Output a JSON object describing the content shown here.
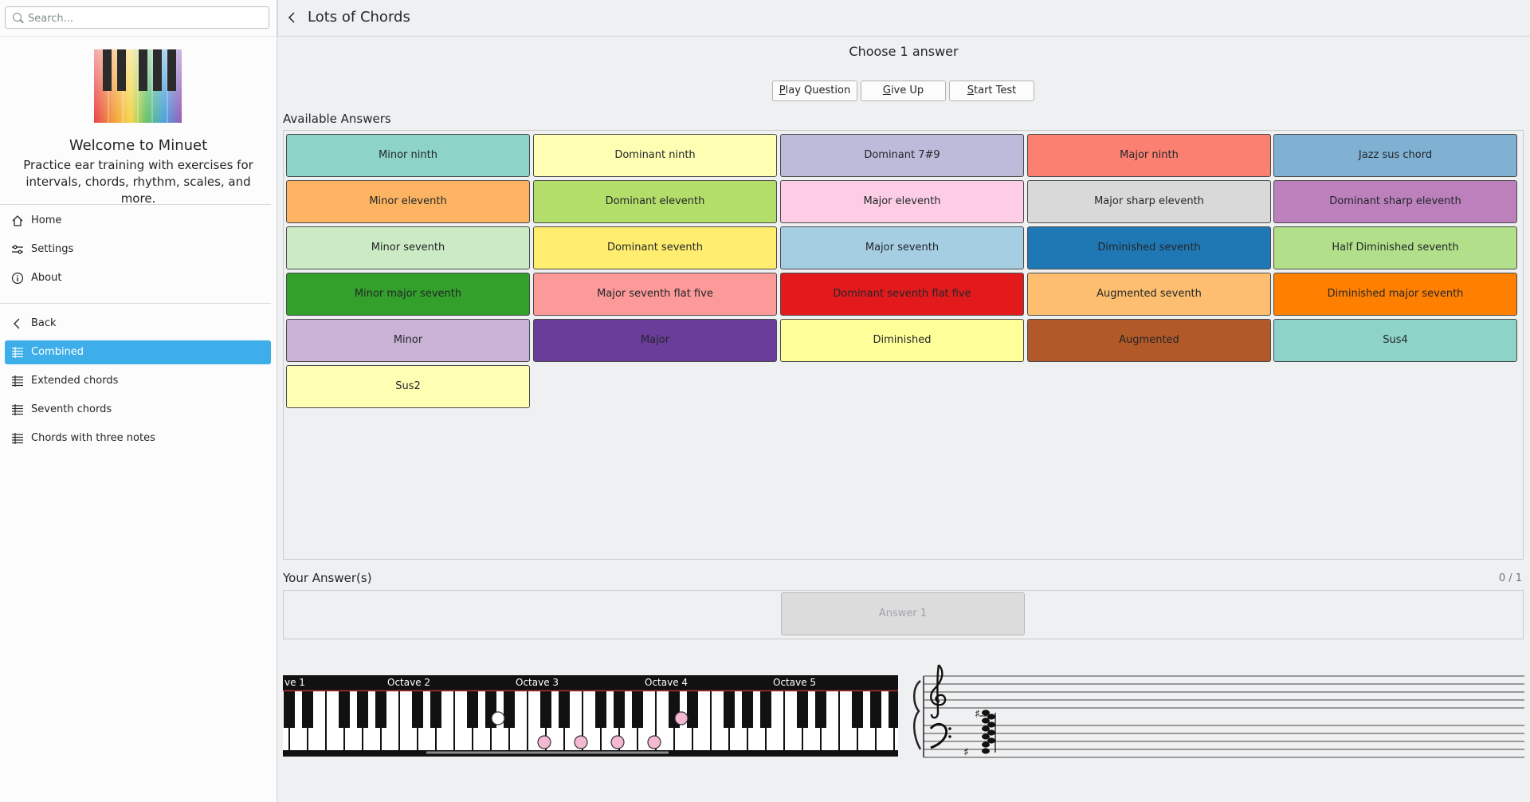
{
  "sidebar": {
    "search_placeholder": "Search...",
    "welcome": "Welcome to Minuet",
    "tagline": "Practice ear training with exercises for intervals, chords, rhythm, scales, and more.",
    "nav": [
      {
        "label": "Home",
        "icon": "home-icon"
      },
      {
        "label": "Settings",
        "icon": "settings-icon"
      },
      {
        "label": "About",
        "icon": "info-icon"
      }
    ],
    "back_label": "Back",
    "categories": [
      {
        "label": "Combined",
        "active": true
      },
      {
        "label": "Extended chords",
        "active": false
      },
      {
        "label": "Seventh chords",
        "active": false
      },
      {
        "label": "Chords with three notes",
        "active": false
      }
    ]
  },
  "header": {
    "title": "Lots of Chords"
  },
  "main": {
    "prompt": "Choose 1 answer",
    "buttons": {
      "play": {
        "first": "P",
        "rest": "lay Question"
      },
      "giveup": {
        "first": "G",
        "rest": "ive Up"
      },
      "start": {
        "first": "S",
        "rest": "tart Test"
      }
    },
    "available_label": "Available Answers",
    "answers": [
      {
        "label": "Minor ninth",
        "color": "#8dd3c7",
        "text": "#232629"
      },
      {
        "label": "Dominant ninth",
        "color": "#ffffb3",
        "text": "#232629"
      },
      {
        "label": "Dominant 7#9",
        "color": "#bebada",
        "text": "#232629"
      },
      {
        "label": "Major ninth",
        "color": "#fb8072",
        "text": "#232629"
      },
      {
        "label": "Jazz sus chord",
        "color": "#80b1d3",
        "text": "#232629"
      },
      {
        "label": "Minor eleventh",
        "color": "#fdb462",
        "text": "#232629"
      },
      {
        "label": "Dominant eleventh",
        "color": "#b3de69",
        "text": "#232629"
      },
      {
        "label": "Major eleventh",
        "color": "#fccde5",
        "text": "#232629"
      },
      {
        "label": "Major sharp eleventh",
        "color": "#d9d9d9",
        "text": "#232629"
      },
      {
        "label": "Dominant sharp eleventh",
        "color": "#bc80bd",
        "text": "#232629"
      },
      {
        "label": "Minor seventh",
        "color": "#ccebc5",
        "text": "#232629"
      },
      {
        "label": "Dominant seventh",
        "color": "#ffed6f",
        "text": "#232629"
      },
      {
        "label": "Major seventh",
        "color": "#a6cee3",
        "text": "#232629"
      },
      {
        "label": "Diminished seventh",
        "color": "#1f78b4",
        "text": "#232629"
      },
      {
        "label": "Half Diminished seventh",
        "color": "#b2df8a",
        "text": "#232629"
      },
      {
        "label": "Minor major seventh",
        "color": "#33a02c",
        "text": "#232629"
      },
      {
        "label": "Major seventh flat five",
        "color": "#fb9a99",
        "text": "#232629"
      },
      {
        "label": "Dominant seventh flat five",
        "color": "#e31a1c",
        "text": "#232629"
      },
      {
        "label": "Augmented seventh",
        "color": "#fdbf6f",
        "text": "#232629"
      },
      {
        "label": "Diminished major seventh",
        "color": "#ff7f00",
        "text": "#232629"
      },
      {
        "label": "Minor",
        "color": "#cab2d6",
        "text": "#232629"
      },
      {
        "label": "Major",
        "color": "#6a3d9a",
        "text": "#232629"
      },
      {
        "label": "Diminished",
        "color": "#ffff99",
        "text": "#232629"
      },
      {
        "label": "Augmented",
        "color": "#b15928",
        "text": "#232629"
      },
      {
        "label": "Sus4",
        "color": "#8dd3c7",
        "text": "#232629"
      },
      {
        "label": "Sus2",
        "color": "#ffffb3",
        "text": "#232629"
      }
    ],
    "your_answers_label": "Your Answer(s)",
    "counter": "0 / 1",
    "answer_slot": "Answer 1"
  },
  "piano": {
    "octaves": [
      "ve 1",
      "Octave 2",
      "Octave 3",
      "Octave 4",
      "Octave 5"
    ]
  }
}
